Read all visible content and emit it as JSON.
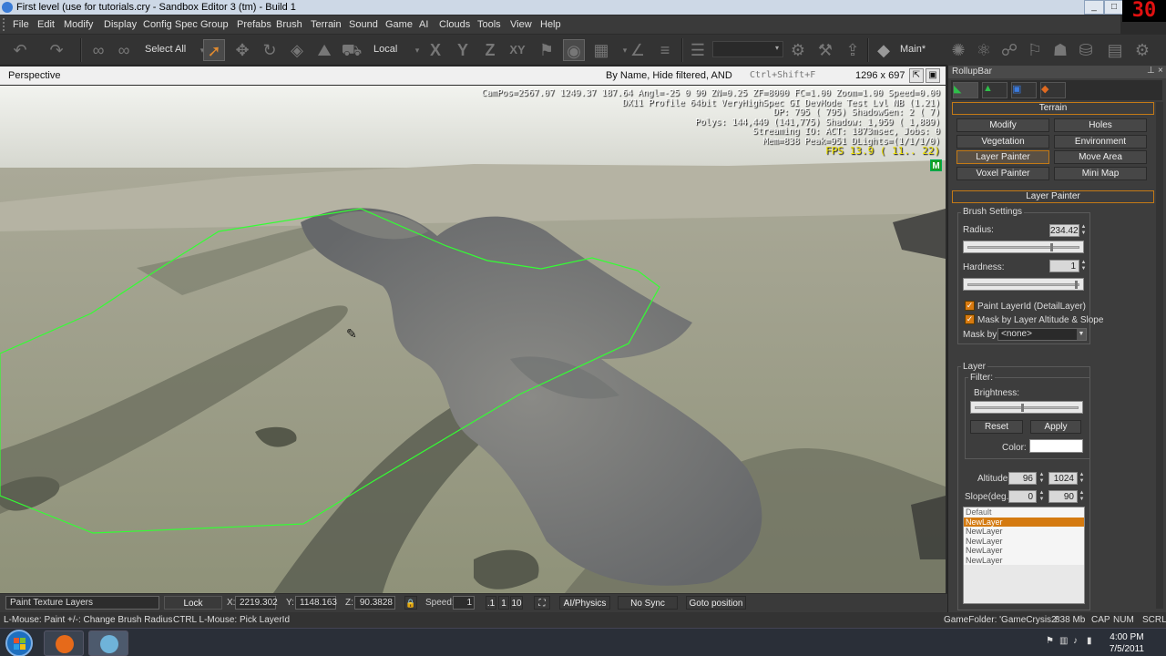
{
  "window": {
    "title": "First level (use for tutorials.cry - Sandbox Editor 3 (tm) - Build 1",
    "fraps_counter": "30"
  },
  "menu": [
    "File",
    "Edit",
    "Modify",
    "Display",
    "Config Spec",
    "Group",
    "Prefabs",
    "Brush",
    "Terrain",
    "Sound",
    "Game",
    "AI",
    "Clouds",
    "Tools",
    "View",
    "Help"
  ],
  "toolbar": {
    "select_all": "Select All",
    "coord_system": "Local",
    "axis_x": "X",
    "axis_y": "Y",
    "axis_z": "Z",
    "axis_xy": "XY",
    "layer_name": "Main*"
  },
  "viewport": {
    "mode": "Perspective",
    "filter": "By Name, Hide filtered, AND",
    "shortcut": "Ctrl+Shift+F",
    "resolution": "1296 x 697",
    "stats": [
      "CamPos=2567.07 1249.37 187.64 Angl=-25  0  90 ZN=0.25 ZF=8000 FC=1.00 Zoom=1.00 Speed=0.00",
      "DX11 Profile 64bit VeryHighSpec GI DevMode Test Lvl NB (1.21)",
      "DP: 795 ( 795) ShadowGen:  2 (  7)",
      "Polys: 144,449 (141,775) Shadow: 1,959 ( 1,889)",
      "Streaming IO: ACT: 1873msec, Jobs: 0",
      "Mem=838 Peak=951 DLights=(1/1/1/0)"
    ],
    "fps": "FPS  13.9 ( 11.. 22)",
    "m_badge": "M"
  },
  "statusbar": {
    "mode_text": "Paint Texture Layers",
    "lock_selection": "Lock Selection",
    "x_label": "X:",
    "x_value": "2219.302",
    "y_label": "Y:",
    "y_value": "1148.163",
    "z_label": "Z:",
    "z_value": "90.3828",
    "speed_label": "Speed:",
    "speed_value": "1",
    "speed_opts": [
      ".1",
      "1",
      "10"
    ],
    "ai_physics": "AI/Physics",
    "no_sync": "No Sync Player",
    "goto": "Goto position",
    "hint1": "L-Mouse: Paint",
    "hint2": "+/-: Change Brush Radius",
    "hint3": "CTRL L-Mouse: Pick LayerId",
    "game_folder": "GameFolder: 'GameCrysis2'",
    "memory": "838 Mb",
    "cap": "CAP",
    "num": "NUM",
    "scrl": "SCRL"
  },
  "rollup": {
    "title": "RollupBar",
    "terrain_header": "Terrain",
    "terrain_buttons": [
      "Modify",
      "Holes",
      "Vegetation",
      "Environment",
      "Layer Painter",
      "Move Area",
      "Voxel Painter",
      "Mini Map"
    ],
    "layer_painter_header": "Layer Painter",
    "brush_settings": "Brush Settings",
    "radius_label": "Radius:",
    "radius_value": "234.42",
    "radius_fraction": 0.77,
    "hardness_label": "Hardness:",
    "hardness_value": "1",
    "hardness_fraction": 0.98,
    "paint_layer_id": "Paint LayerId (DetailLayer)",
    "mask_altitude": "Mask by Layer Altitude & Slope",
    "mask_by_label": "Mask by",
    "mask_by_value": "<none>",
    "layer_group": "Layer",
    "filter_label": "Filter:",
    "brightness_label": "Brightness:",
    "brightness_fraction": 0.5,
    "reset": "Reset",
    "apply": "Apply",
    "color_label": "Color:",
    "color_value": "#ffffff",
    "altitude_label": "Altitude",
    "altitude_min": "96",
    "altitude_max": "1024",
    "slope_label": "Slope(deg.)",
    "slope_min": "0",
    "slope_max": "90",
    "layers": [
      "Default",
      "NewLayer",
      "NewLayer",
      "NewLayer",
      "NewLayer",
      "NewLayer"
    ],
    "selected_layer_index": 1
  },
  "taskbar": {
    "time": "4:00 PM",
    "date": "7/5/2011"
  },
  "colors": {
    "accent": "#d47a10",
    "selection_outline": "#33ff33"
  }
}
